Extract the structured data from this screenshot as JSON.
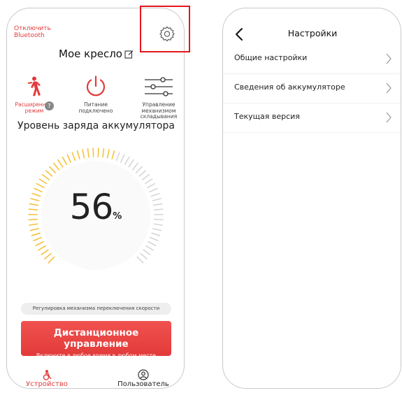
{
  "left_screen": {
    "bluetooth_link": "Отключить Bluetooth",
    "chair_title": "Мое кресло",
    "controls": [
      {
        "label": "Расширенный режим",
        "icon": "walking-person-icon"
      },
      {
        "label": "Питание подключено",
        "icon": "power-icon"
      },
      {
        "label": "Управление механизмом складывания",
        "icon": "sliders-icon"
      }
    ],
    "help_badge": "?",
    "battery": {
      "title": "Уровень заряда аккумулятора",
      "value": 56,
      "value_text": "56",
      "unit": "%"
    },
    "speed_pill": "Регулировка механизма переключения скорости",
    "remote": {
      "title": "Дистанционное управление",
      "subtitle": "Включите в любое время в любом месте"
    },
    "tabs": [
      {
        "label": "Устройство",
        "icon": "device-icon",
        "active": true
      },
      {
        "label": "Пользователь",
        "icon": "user-icon",
        "active": false
      }
    ]
  },
  "right_screen": {
    "title": "Настройки",
    "items": [
      {
        "label": "Общие настройки"
      },
      {
        "label": "Сведения об аккумуляторе"
      },
      {
        "label": "Текущая версия"
      }
    ]
  },
  "colors": {
    "accent_red": "#e23b3b",
    "highlight_red": "#e4161c",
    "gauge_yellow": "#f6c23c",
    "gauge_grey": "#d6d6d6"
  }
}
